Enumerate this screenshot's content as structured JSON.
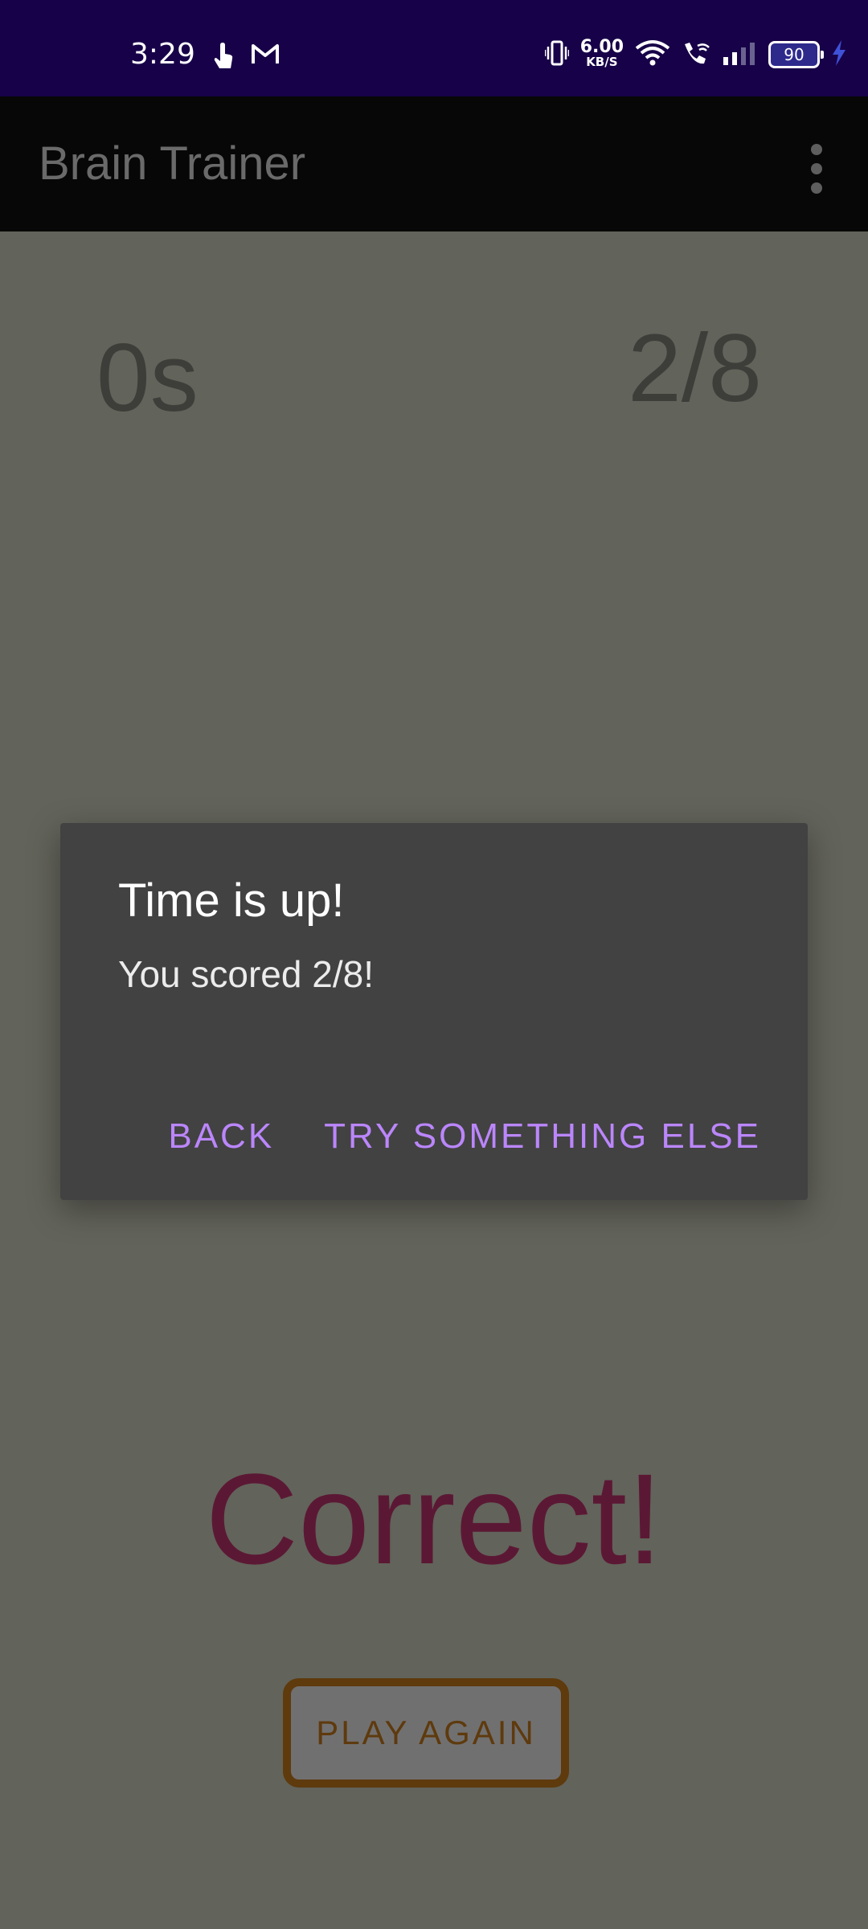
{
  "status_bar": {
    "time": "3:29",
    "left_icons": [
      "touch-hand-icon",
      "gmail-icon"
    ],
    "right_icons": [
      "vibrate-icon",
      "wifi-icon",
      "wifi-call-icon",
      "signal-icon",
      "charging-bolt-icon"
    ],
    "net_speed_value": "6.00",
    "net_speed_unit": "KB/S",
    "battery_level": "90"
  },
  "app_bar": {
    "title": "Brain Trainer",
    "overflow_icon": "more-vert-icon"
  },
  "game": {
    "timer": "0s",
    "score": "2/8",
    "result": "Correct!",
    "play_again_label": "PLAY AGAIN"
  },
  "dialog": {
    "title": "Time is up!",
    "message": "You scored 2/8!",
    "back_label": "BACK",
    "try_label": "TRY SOMETHING ELSE"
  },
  "colors": {
    "status_bar_bg": "#170148",
    "app_bar_bg": "#070707",
    "screen_bg": "#62635a",
    "dialog_bg": "#424242",
    "dialog_button": "#bb86fc",
    "result_text": "#5b1834",
    "play_again_border": "#5e3a0d"
  }
}
